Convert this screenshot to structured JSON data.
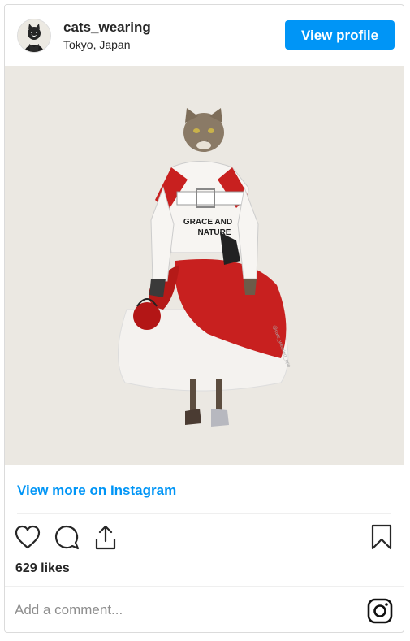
{
  "profile": {
    "username": "cats_wearing",
    "location": "Tokyo, Japan",
    "view_profile_label": "View profile"
  },
  "post": {
    "artwork_text_line1": "GRACE AND",
    "artwork_text_line2": "NATURE",
    "watermark": "@cats_wearing_app",
    "view_more_label": "View more on Instagram",
    "likes": "629 likes"
  },
  "comment": {
    "placeholder": "Add a comment..."
  },
  "icons": {
    "like": "heart-icon",
    "comment": "comment-bubble-icon",
    "share": "share-icon",
    "save": "bookmark-icon",
    "instagram": "instagram-logo-icon"
  },
  "colors": {
    "accent": "#0095f6",
    "dress_red": "#c8201f",
    "background": "#ebe8e2"
  }
}
